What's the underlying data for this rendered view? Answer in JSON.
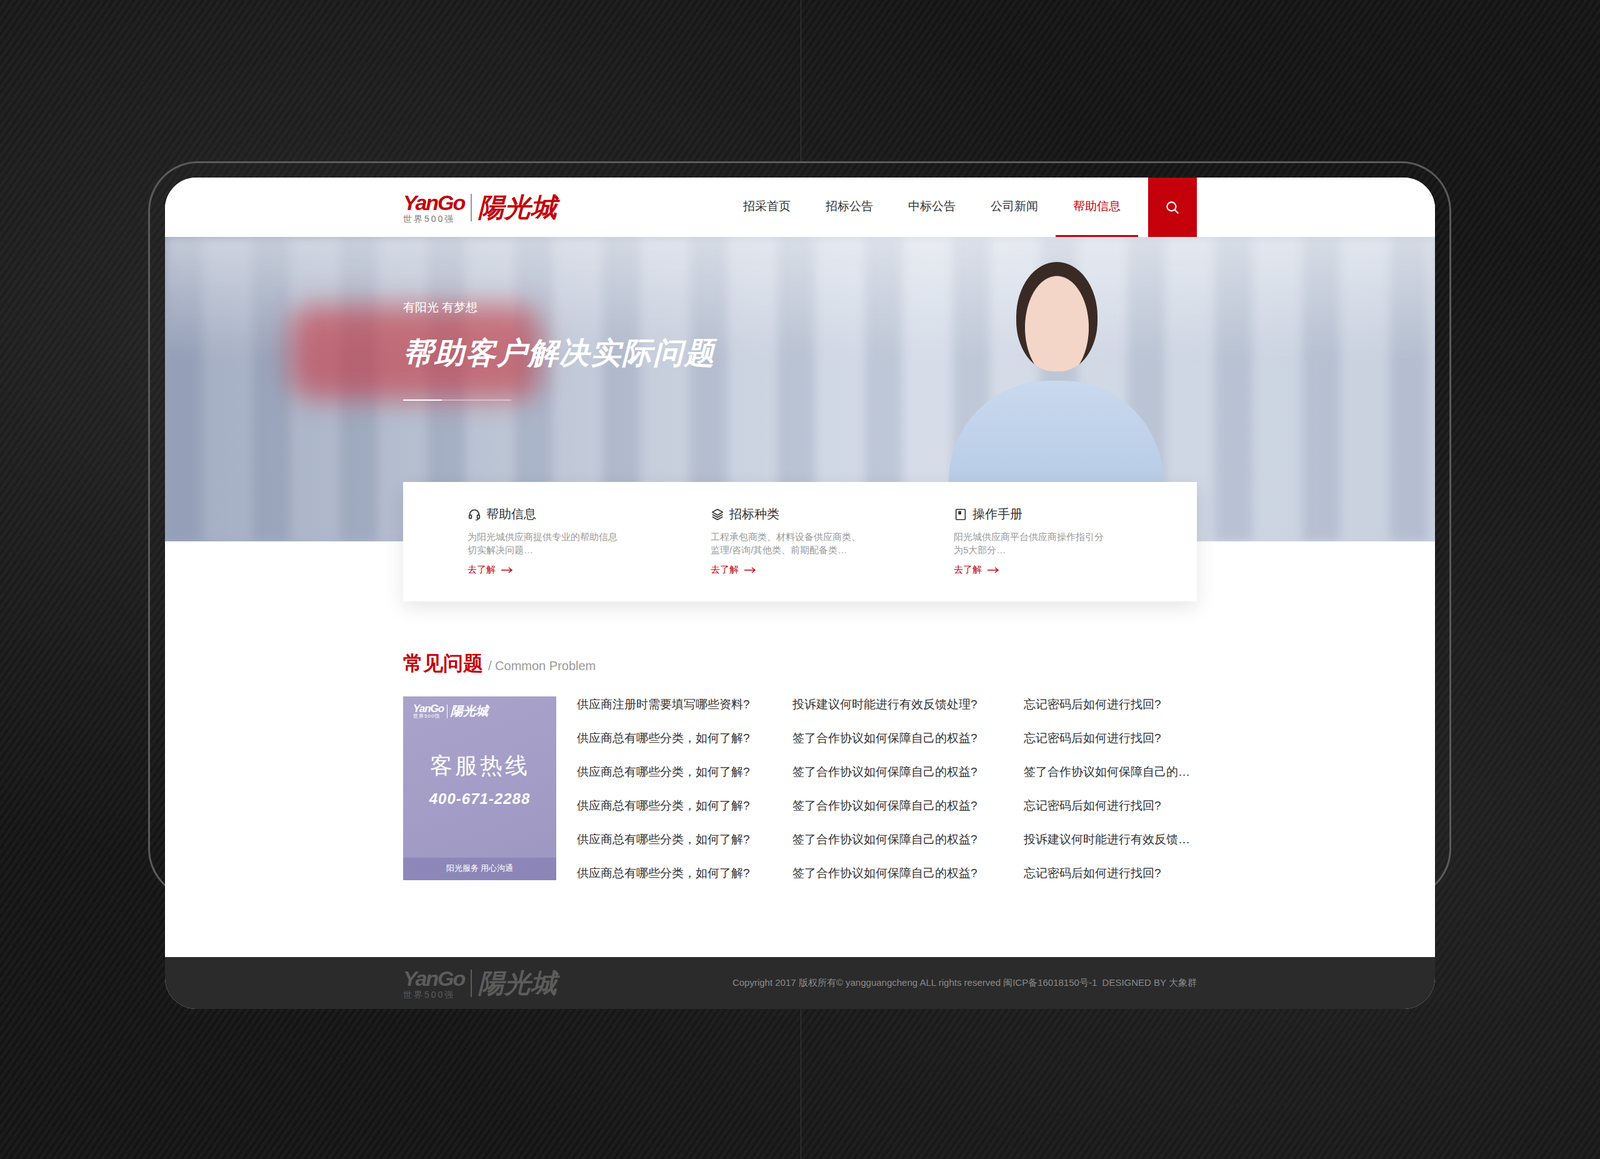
{
  "logo": {
    "brand": "YanGo",
    "tagline": "世界500强",
    "name": "陽光城"
  },
  "nav": [
    {
      "label": "招采首页",
      "selected": false
    },
    {
      "label": "招标公告",
      "selected": false
    },
    {
      "label": "中标公告",
      "selected": false
    },
    {
      "label": "公司新闻",
      "selected": false
    },
    {
      "label": "帮助信息",
      "selected": true
    }
  ],
  "banner": {
    "eyebrow": "有阳光 有梦想",
    "title": "帮助客户解决实际问题"
  },
  "features": [
    {
      "kind": "headset",
      "title": "帮助信息",
      "lines": [
        "为阳光城供应商提供专业的帮助信息",
        "切实解决问题…"
      ],
      "link": "去了解"
    },
    {
      "kind": "layers",
      "title": "招标种类",
      "lines": [
        "工程承包商类、材料设备供应商类、",
        "监理/咨询/其他类、前期配备类…"
      ],
      "link": "去了解"
    },
    {
      "kind": "book",
      "title": "操作手册",
      "lines": [
        "阳光城供应商平台供应商操作指引分",
        "为5大部分…"
      ],
      "link": "去了解"
    }
  ],
  "faq": {
    "title": "常见问题",
    "subtitle": "/ Common Problem",
    "hotline": {
      "brand": "YanGo",
      "tagline": "世界500强",
      "name": "陽光城",
      "title": "客服热线",
      "phone": "400-671-2288",
      "slogan": "阳光服务 用心沟通"
    },
    "columns": [
      [
        "供应商注册时需要填写哪些资料?",
        "供应商总有哪些分类，如何了解?",
        "供应商总有哪些分类，如何了解?",
        "供应商总有哪些分类，如何了解?",
        "供应商总有哪些分类，如何了解?",
        "供应商总有哪些分类，如何了解?"
      ],
      [
        "投诉建议何时能进行有效反馈处理?",
        "签了合作协议如何保障自己的权益?",
        "签了合作协议如何保障自己的权益?",
        "签了合作协议如何保障自己的权益?",
        "签了合作协议如何保障自己的权益?",
        "签了合作协议如何保障自己的权益?"
      ],
      [
        "忘记密码后如何进行找回?",
        "忘记密码后如何进行找回?",
        "签了合作协议如何保障自己的…",
        "忘记密码后如何进行找回?",
        "投诉建议何时能进行有效反馈…",
        "忘记密码后如何进行找回?"
      ]
    ]
  },
  "footer": {
    "logo": {
      "brand": "YanGo",
      "tagline": "世界500强",
      "name": "陽光城"
    },
    "copyright": "Copyright 2017 版权所有© yangguangcheng ALL rights reserved 闽ICP备16018150号-1  DESIGNED BY 大象群"
  }
}
